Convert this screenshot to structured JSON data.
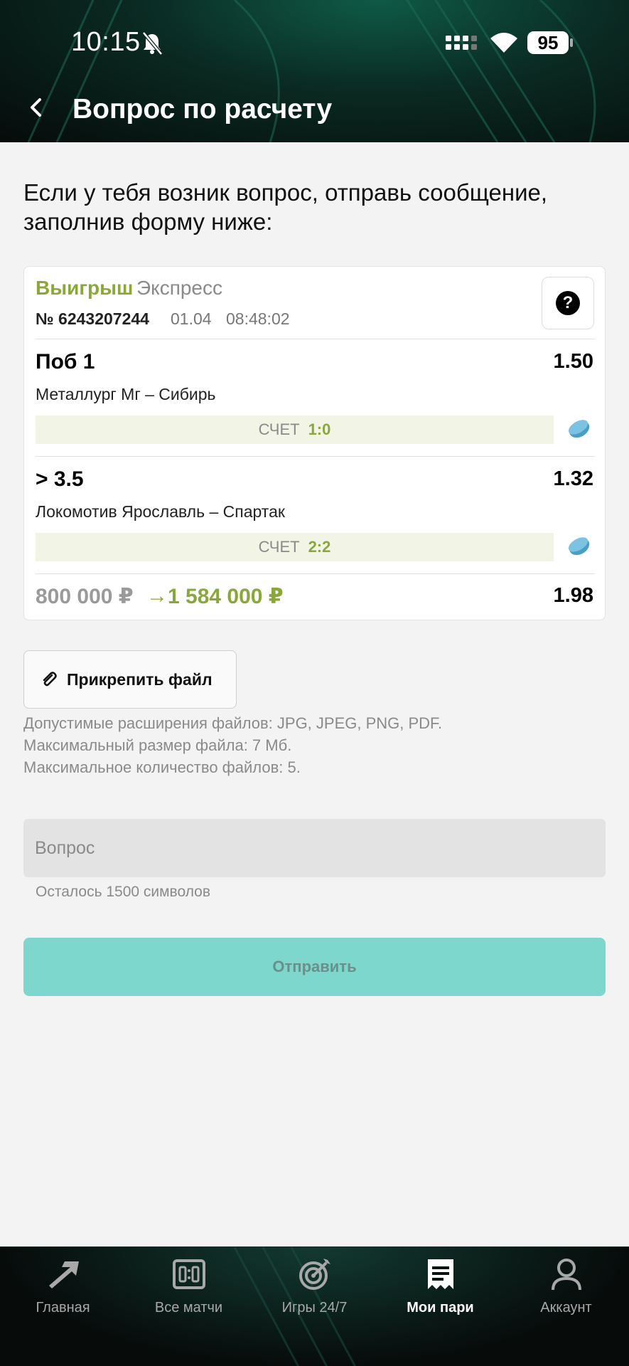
{
  "status_bar": {
    "time": "10:15",
    "battery": "95"
  },
  "header": {
    "title": "Вопрос по расчету"
  },
  "intro_text": "Если у тебя возник вопрос, отправь сообщение, заполнив форму ниже:",
  "bet": {
    "status": "Выигрыш",
    "type": "Экспресс",
    "number": "№ 6243207244",
    "date": "01.04",
    "time": "08:48:02",
    "selections": [
      {
        "outcome": "Поб 1",
        "odds": "1.50",
        "match": "Металлург Мг – Сибирь",
        "score_label": "СЧЕТ",
        "score": "1:0"
      },
      {
        "outcome": "> 3.5",
        "odds": "1.32",
        "match": "Локомотив Ярославль – Спартак",
        "score_label": "СЧЕТ",
        "score": "2:2"
      }
    ],
    "stake": "800 000 ₽",
    "arrow": "→",
    "win": "1 584 000 ₽",
    "total_odds": "1.98"
  },
  "attach": {
    "label": "Прикрепить файл",
    "hints": [
      "Допустимые расширения файлов: JPG, JPEG, PNG, PDF.",
      "Максимальный размер файла: 7 Мб.",
      "Максимальное количество файлов: 5."
    ]
  },
  "question": {
    "placeholder": "Вопрос",
    "chars_left": "Осталось 1500 символов"
  },
  "submit_label": "Отправить",
  "tabs": [
    {
      "label": "Главная",
      "icon": "home-arrow-icon"
    },
    {
      "label": "Все матчи",
      "icon": "scoreboard-icon"
    },
    {
      "label": "Игры 24/7",
      "icon": "target-icon"
    },
    {
      "label": "Мои пари",
      "icon": "receipt-icon",
      "active": true
    },
    {
      "label": "Аккаунт",
      "icon": "user-icon"
    }
  ],
  "colors": {
    "accent_green": "#8aa83a",
    "submit_teal": "#7dd7cc",
    "header_dark": "#0a2a22"
  }
}
